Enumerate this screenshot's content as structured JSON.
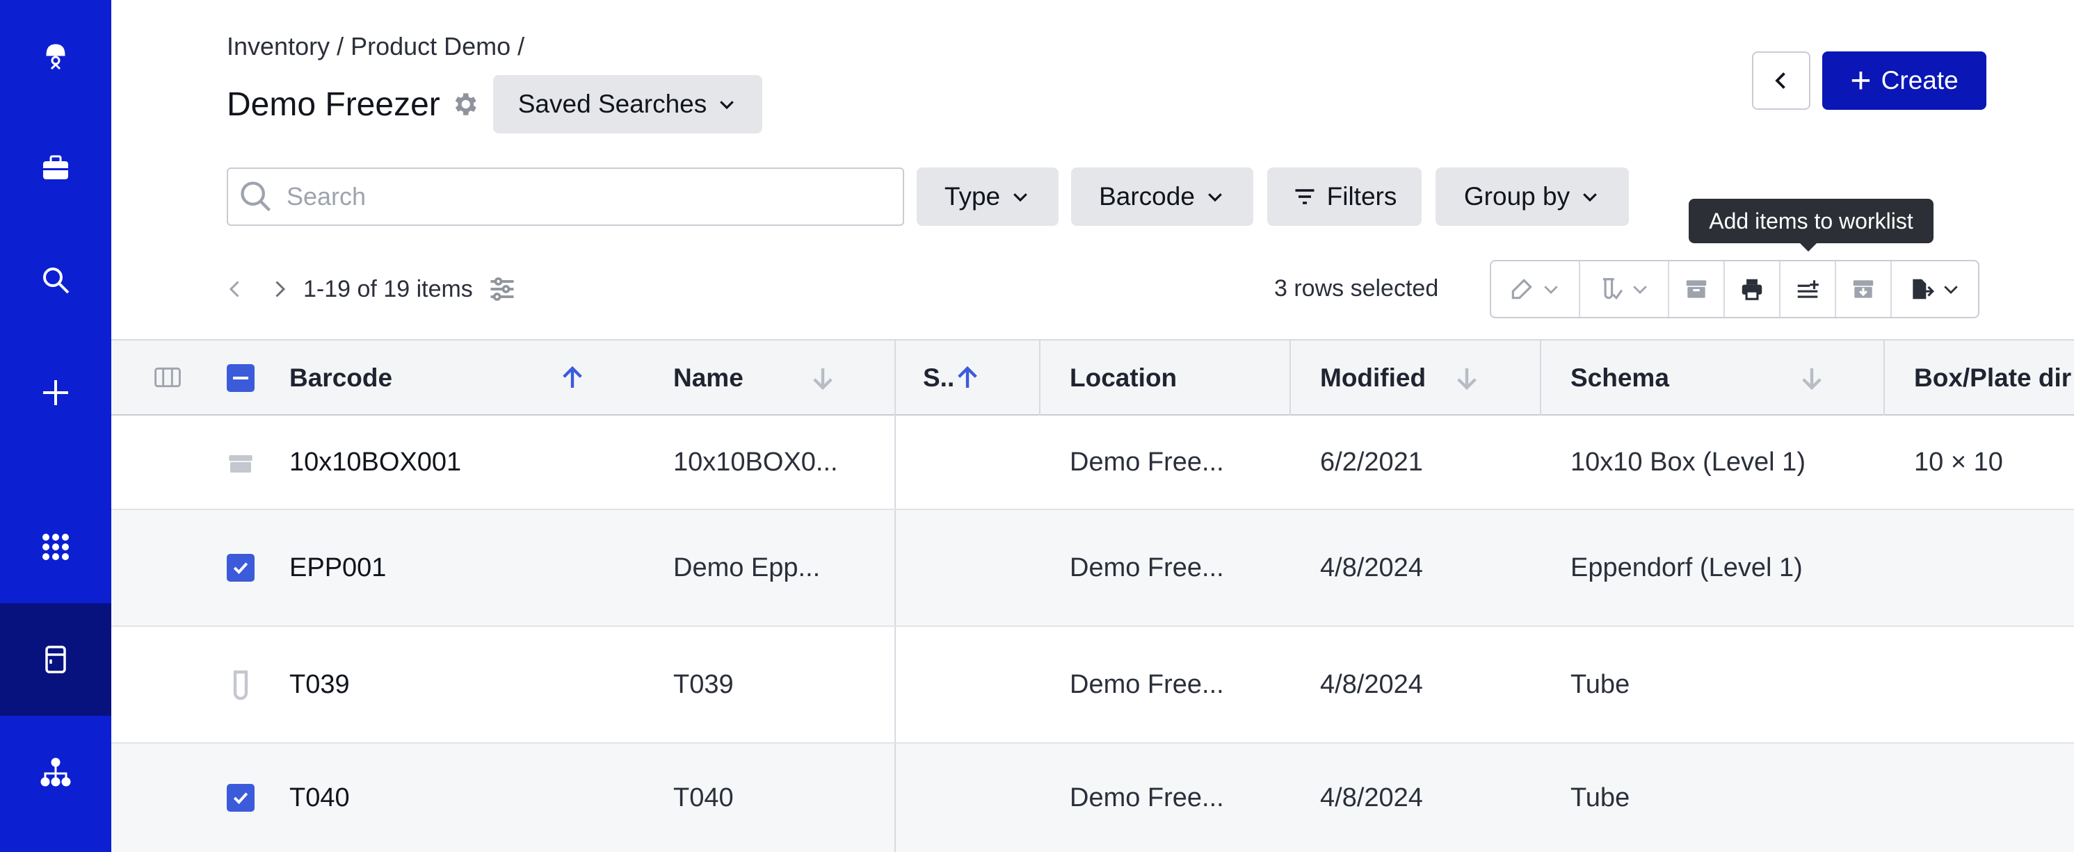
{
  "breadcrumb": "Inventory / Product Demo /",
  "page_title": "Demo Freezer",
  "saved_searches_label": "Saved Searches",
  "create_label": "Create",
  "search": {
    "placeholder": "Search",
    "value": ""
  },
  "filters": {
    "type": "Type",
    "barcode": "Barcode",
    "filters": "Filters",
    "group_by": "Group by"
  },
  "tooltip": "Add items to worklist",
  "pager": {
    "range": "1-19 of 19 items"
  },
  "rows_selected": "3 rows selected",
  "columns": {
    "barcode": "Barcode",
    "name": "Name",
    "s": "S..",
    "location": "Location",
    "modified": "Modified",
    "schema": "Schema",
    "dims": "Box/Plate dir"
  },
  "rows": [
    {
      "icon": "box-icon",
      "selected": false,
      "barcode": "10x10BOX001",
      "name": "10x10BOX0...",
      "location": "Demo Free...",
      "modified": "6/2/2021",
      "schema": "10x10 Box (Level 1)",
      "dims": "10 × 10"
    },
    {
      "icon": "checkbox",
      "selected": true,
      "barcode": "EPP001",
      "name": "Demo Epp...",
      "location": "Demo Free...",
      "modified": "4/8/2024",
      "schema": "Eppendorf (Level 1)",
      "dims": ""
    },
    {
      "icon": "tube-icon",
      "selected": false,
      "barcode": "T039",
      "name": "T039",
      "location": "Demo Free...",
      "modified": "4/8/2024",
      "schema": "Tube",
      "dims": ""
    },
    {
      "icon": "checkbox",
      "selected": true,
      "barcode": "T040",
      "name": "T040",
      "location": "Demo Free...",
      "modified": "4/8/2024",
      "schema": "Tube",
      "dims": ""
    }
  ],
  "colors": {
    "sidebar": "#0c1fd1",
    "sidebar_active": "#07127f",
    "primary": "#0a16b5",
    "checkbox": "#3b5bdb",
    "sort_active": "#3b5bdb"
  }
}
